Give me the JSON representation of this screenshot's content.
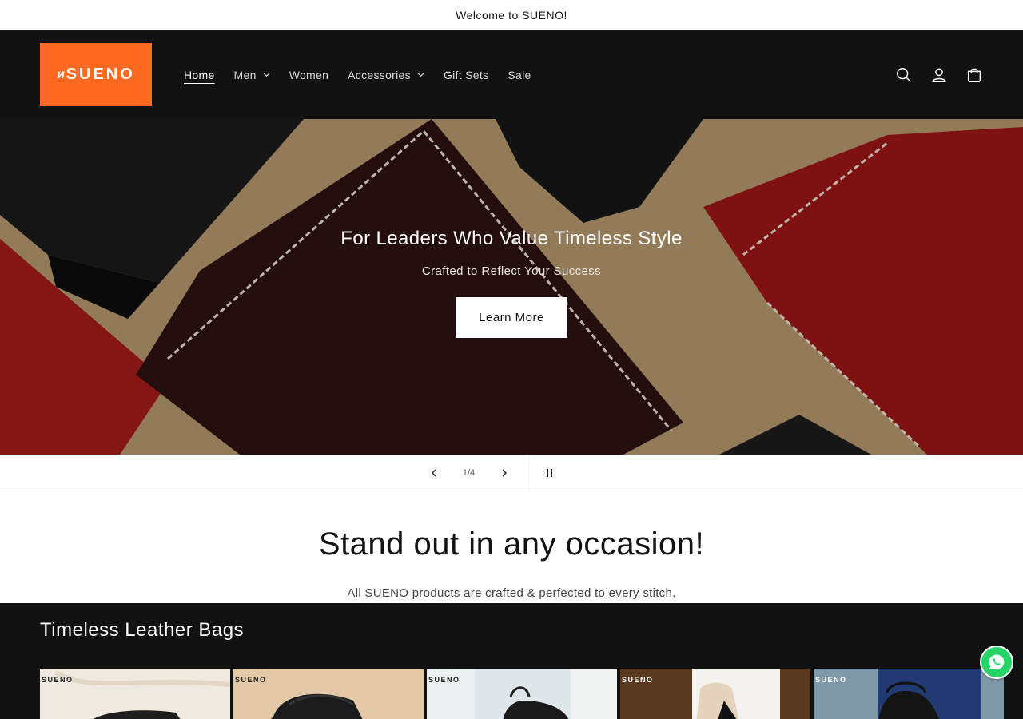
{
  "announcement": "Welcome to SUENO!",
  "brand": {
    "name": "SUENO",
    "color": "#ff6a20"
  },
  "nav": {
    "items": [
      {
        "label": "Home",
        "active": true,
        "dropdown": false
      },
      {
        "label": "Men",
        "active": false,
        "dropdown": true
      },
      {
        "label": "Women",
        "active": false,
        "dropdown": false
      },
      {
        "label": "Accessories",
        "active": false,
        "dropdown": true
      },
      {
        "label": "Gift Sets",
        "active": false,
        "dropdown": false
      },
      {
        "label": "Sale",
        "active": false,
        "dropdown": false
      }
    ],
    "icons": [
      "search-icon",
      "account-icon",
      "cart-icon"
    ]
  },
  "hero": {
    "title": "For Leaders Who Value Timeless Style",
    "subtitle": "Crafted to Reflect Your Success",
    "button": "Learn More"
  },
  "slider": {
    "counter": "1/4"
  },
  "intro": {
    "heading": "Stand out in any occasion!",
    "text": "All SUENO products are crafted & perfected to every stitch."
  },
  "collection": {
    "title": "Timeless Leather Bags",
    "card_brand": "SUENO"
  }
}
